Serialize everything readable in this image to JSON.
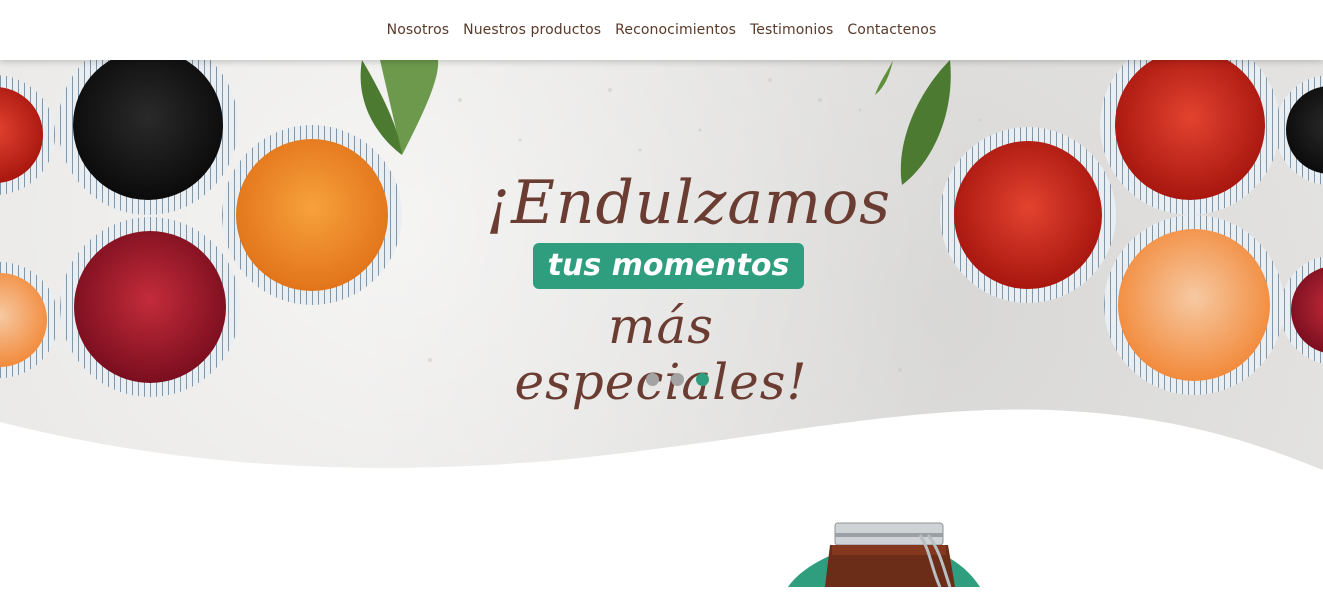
{
  "nav": {
    "links": [
      "Nosotros",
      "Nuestros productos",
      "Reconocimientos",
      "Testimonios",
      "Contactenos"
    ]
  },
  "hero": {
    "line1": "¡Endulzamos",
    "pill": "tus momentos",
    "line3": "más especiales!",
    "slides": {
      "count": 3,
      "active_index": 2
    }
  },
  "colors": {
    "accent_green": "#2f9e7f",
    "brown_text": "#6b3d32",
    "nav_text": "#5a3a2a",
    "dot_inactive": "#a3a3a3"
  }
}
